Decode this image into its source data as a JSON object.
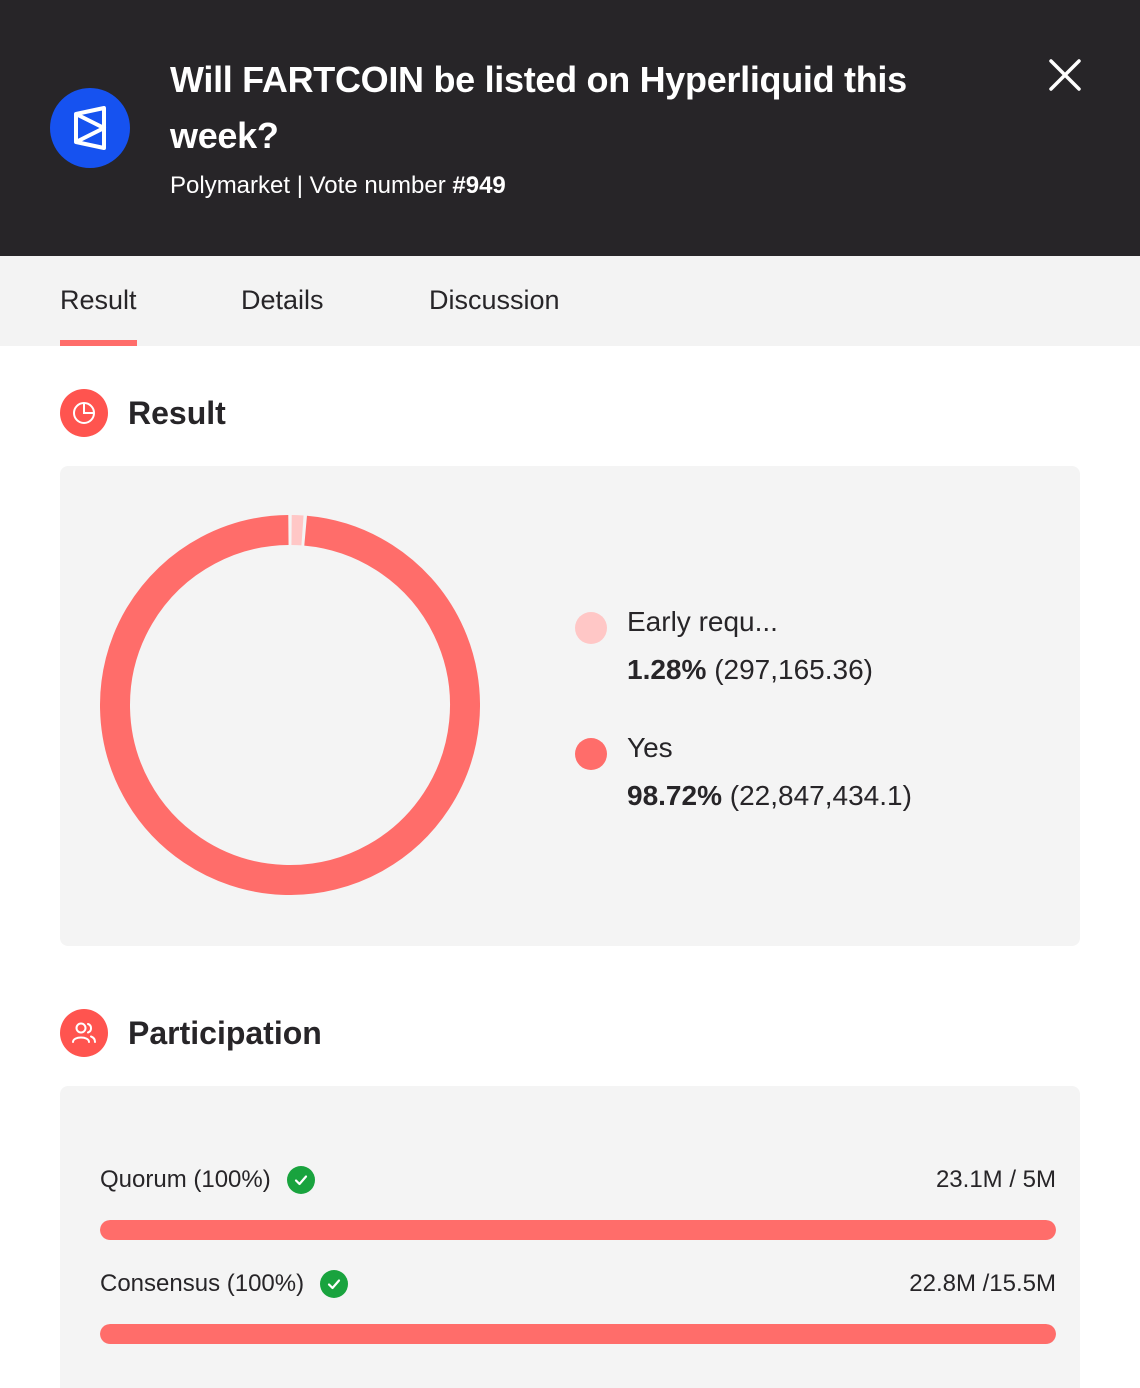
{
  "header": {
    "title": "Will FARTCOIN be listed on Hyperliquid this week?",
    "source": "Polymarket",
    "separator": " | Vote number ",
    "vote_number": "#949",
    "logo_icon": "polymarket-logo",
    "close_icon": "close-icon"
  },
  "tabs": [
    {
      "label": "Result",
      "active": true
    },
    {
      "label": "Details",
      "active": false
    },
    {
      "label": "Discussion",
      "active": false
    }
  ],
  "result": {
    "title": "Result",
    "icon": "pie-chart-icon",
    "legend": [
      {
        "label": "Early requ...",
        "percent": "1.28%",
        "amount": "(297,165.36)",
        "color": "#ffc7c6"
      },
      {
        "label": "Yes",
        "percent": "98.72%",
        "amount": "(22,847,434.1)",
        "color": "#ff6d6a"
      }
    ]
  },
  "chart_data": {
    "type": "pie",
    "categories": [
      "Early requ...",
      "Yes"
    ],
    "values": [
      1.28,
      98.72
    ],
    "colors": [
      "#ffc7c6",
      "#ff6d6a"
    ],
    "title": "",
    "donut": true
  },
  "participation": {
    "title": "Participation",
    "icon": "users-icon",
    "rows": [
      {
        "label": "Quorum (100%)",
        "value": "23.1M / 5M",
        "fill": 1.0,
        "check_icon": "check-icon"
      },
      {
        "label": "Consensus (100%)",
        "value": "22.8M /15.5M",
        "fill": 1.0,
        "check_icon": "check-icon"
      }
    ]
  },
  "colors": {
    "header_bg": "#272528",
    "accent": "#ff6d6a",
    "logo_blue": "#1652f0",
    "check_green": "#19a33e"
  }
}
